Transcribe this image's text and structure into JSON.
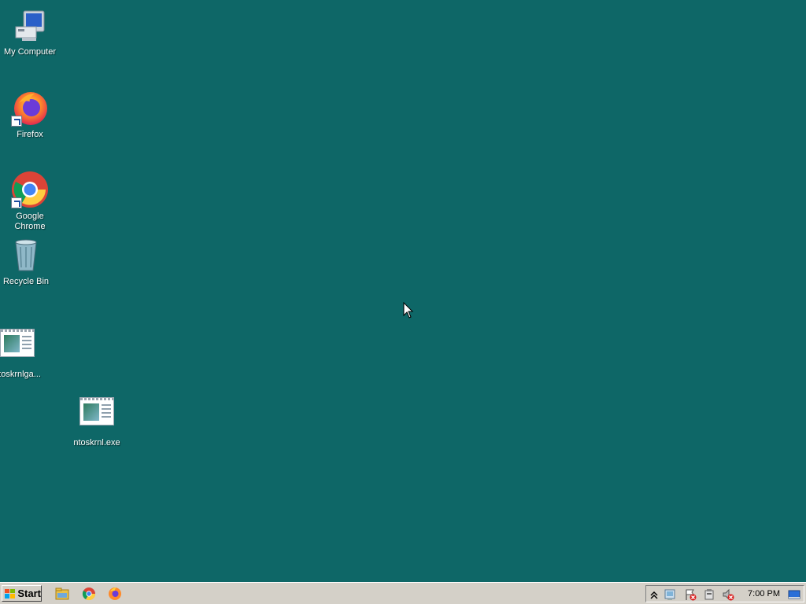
{
  "desktop": {
    "background": "#0e6767",
    "icons": [
      {
        "label": "My Computer",
        "icon": "my-computer-icon"
      },
      {
        "label": "Firefox",
        "icon": "firefox-icon"
      },
      {
        "label": "Google Chrome",
        "icon": "chrome-icon"
      },
      {
        "label": "Recycle Bin",
        "icon": "recycle-bin-icon"
      },
      {
        "label": "ntoskrnlga...",
        "icon": "exe-file-icon"
      },
      {
        "label": "ntoskrnl.exe",
        "icon": "exe-file-icon"
      }
    ]
  },
  "taskbar": {
    "start_label": "Start",
    "quick_launch": [
      "explorer-icon",
      "chrome-icon",
      "firefox-icon"
    ],
    "tray_icons": [
      "show-hidden-icons",
      "network-icon",
      "action-center-flag-icon",
      "power-icon",
      "volume-muted-icon"
    ],
    "clock": "7:00 PM"
  }
}
